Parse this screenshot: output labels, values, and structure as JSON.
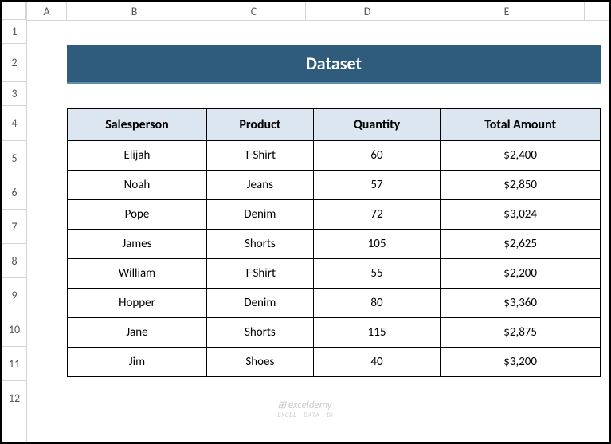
{
  "columns": [
    "A",
    "B",
    "C",
    "D",
    "E"
  ],
  "rows": [
    "1",
    "2",
    "3",
    "4",
    "5",
    "6",
    "7",
    "8",
    "9",
    "10",
    "11",
    "12"
  ],
  "title": "Dataset",
  "headers": {
    "salesperson": "Salesperson",
    "product": "Product",
    "quantity": "Quantity",
    "total": "Total Amount"
  },
  "data": [
    {
      "salesperson": "Elijah",
      "product": "T-Shirt",
      "quantity": "60",
      "total": "$2,400"
    },
    {
      "salesperson": "Noah",
      "product": "Jeans",
      "quantity": "57",
      "total": "$2,850"
    },
    {
      "salesperson": "Pope",
      "product": "Denim",
      "quantity": "72",
      "total": "$3,024"
    },
    {
      "salesperson": "James",
      "product": "Shorts",
      "quantity": "105",
      "total": "$2,625"
    },
    {
      "salesperson": "William",
      "product": "T-Shirt",
      "quantity": "55",
      "total": "$2,200"
    },
    {
      "salesperson": "Hopper",
      "product": "Denim",
      "quantity": "80",
      "total": "$3,360"
    },
    {
      "salesperson": "Jane",
      "product": "Shorts",
      "quantity": "115",
      "total": "$2,875"
    },
    {
      "salesperson": "Jim",
      "product": "Shoes",
      "quantity": "40",
      "total": "$3,200"
    }
  ],
  "watermark": {
    "main": "exceldemy",
    "sub": "EXCEL · DATA · BI"
  }
}
